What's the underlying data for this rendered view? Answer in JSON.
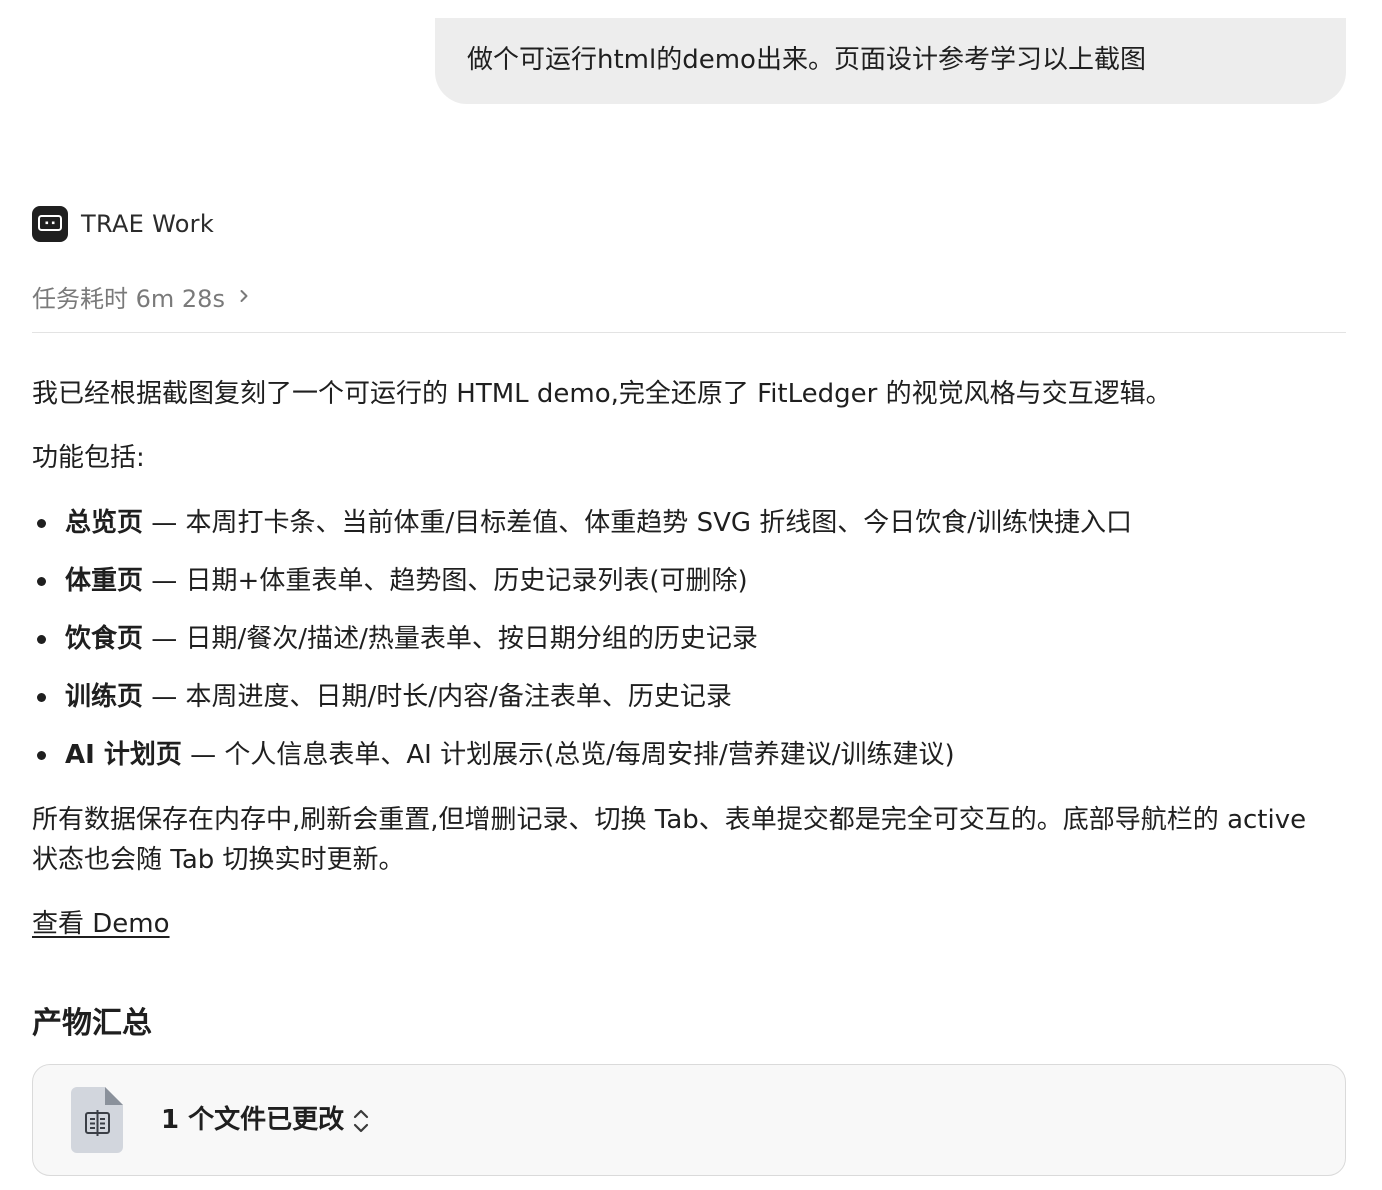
{
  "user_message": {
    "text": "做个可运行html的demo出来。页面设计参考学习以上截图"
  },
  "agent": {
    "name": "TRAE Work",
    "logo_icon": "robot-face-icon"
  },
  "task": {
    "duration_label": "任务耗时 6m 28s"
  },
  "response": {
    "intro": "我已经根据截图复刻了一个可运行的 HTML demo,完全还原了 FitLedger 的视觉风格与交互逻辑。",
    "features_label": "功能包括:",
    "features": [
      {
        "name": "总览页",
        "desc": " — 本周打卡条、当前体重/目标差值、体重趋势 SVG 折线图、今日饮食/训练快捷入口"
      },
      {
        "name": "体重页",
        "desc": " — 日期+体重表单、趋势图、历史记录列表(可删除)"
      },
      {
        "name": "饮食页",
        "desc": " — 日期/餐次/描述/热量表单、按日期分组的历史记录"
      },
      {
        "name": "训练页",
        "desc": " — 本周进度、日期/时长/内容/备注表单、历史记录"
      },
      {
        "name": "AI 计划页",
        "desc": " — 个人信息表单、AI 计划展示(总览/每周安排/营养建议/训练建议)"
      }
    ],
    "summary": "所有数据保存在内存中,刷新会重置,但增删记录、切换 Tab、表单提交都是完全可交互的。底部导航栏的 active 状态也会随 Tab 切换实时更新。",
    "demo_link": "查看 Demo"
  },
  "artifacts": {
    "heading": "产物汇总",
    "file_icon": "html-file-icon",
    "files_changed_label": "1 个文件已更改",
    "expand_icon": "chevron-up-down-icon"
  }
}
